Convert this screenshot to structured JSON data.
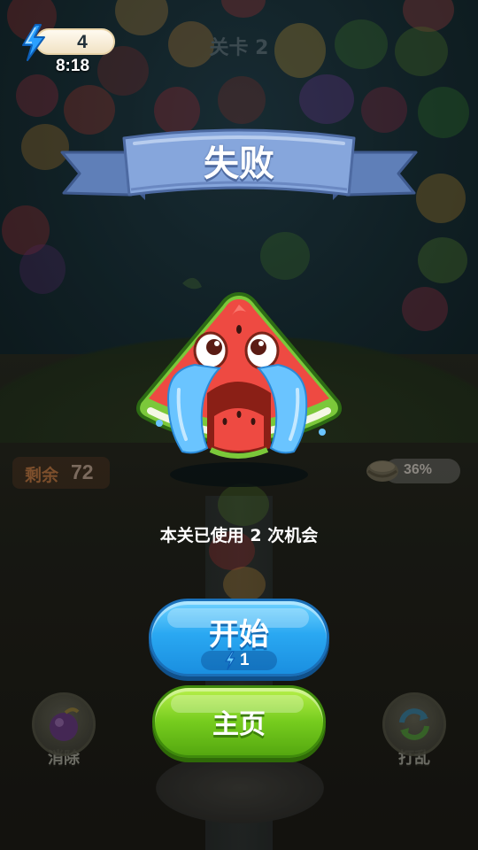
{
  "hud": {
    "energy_count": "4",
    "energy_timer": "8:18",
    "level_title": "关卡 2",
    "remaining_label": "剩余",
    "remaining_count": "72",
    "progress_percent": "36%"
  },
  "tools": {
    "eliminate_label": "消除",
    "shuffle_label": "打乱"
  },
  "dialog": {
    "title": "失败",
    "message": "本关已使用 2 次机会",
    "start_label": "开始",
    "start_cost": "1",
    "home_label": "主页"
  },
  "colors": {
    "ribbon": "#7f9fd6",
    "start_button": "#2aa8f2",
    "home_button": "#76cc1e",
    "energy_bolt": "#2aa0ff"
  }
}
